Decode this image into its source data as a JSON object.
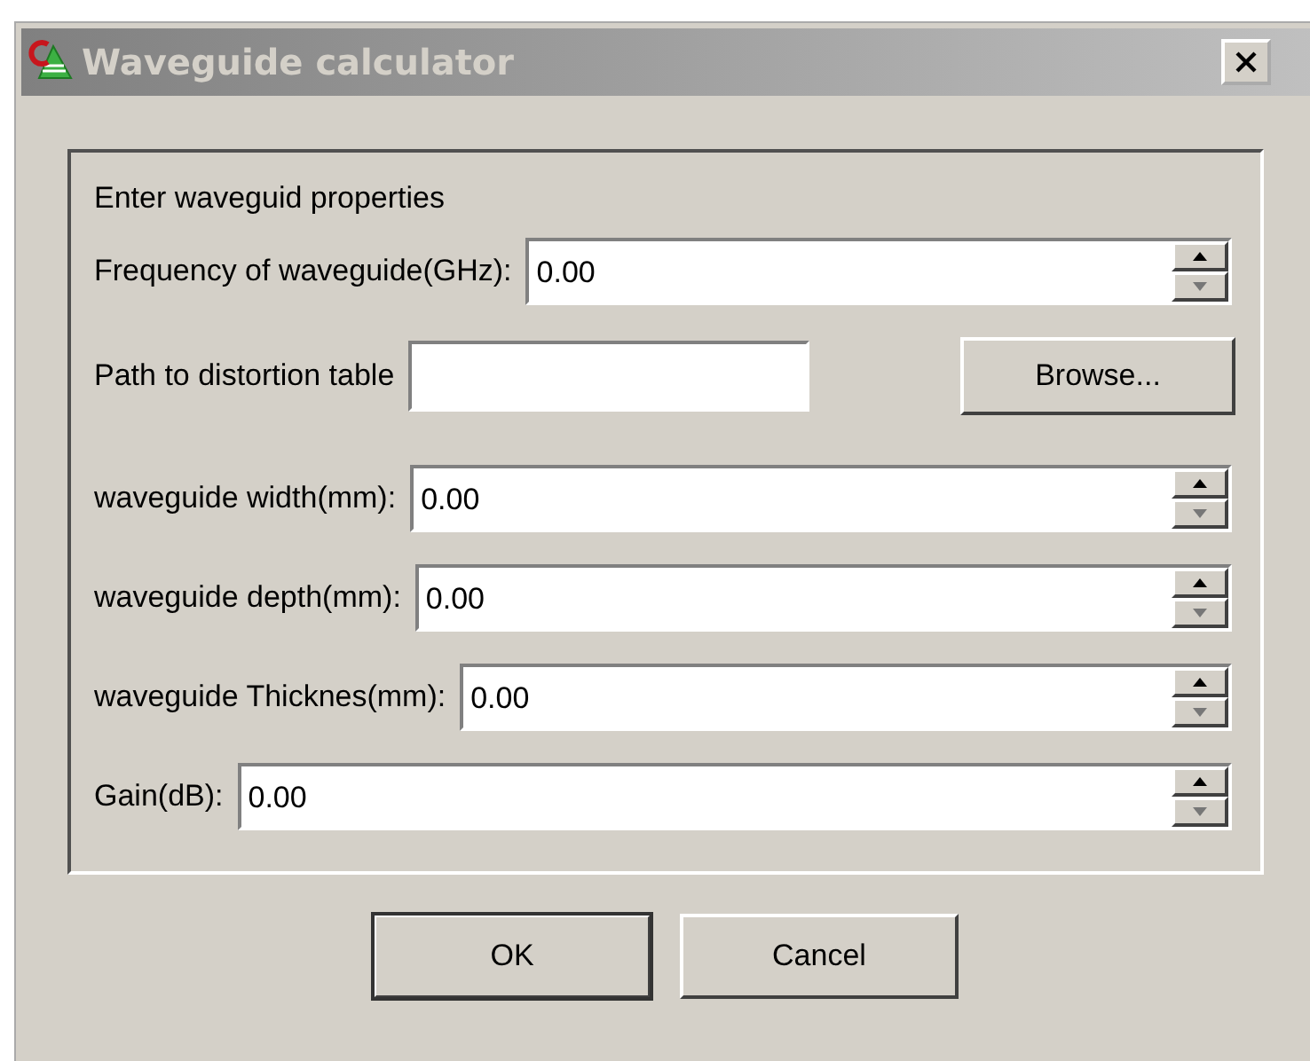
{
  "window": {
    "title": "Waveguide calculator"
  },
  "group": {
    "heading": "Enter waveguid properties",
    "rows": [
      {
        "kind": "spin",
        "label": "Frequency of waveguide(GHz):",
        "value": "0.00"
      },
      {
        "kind": "file",
        "label": "Path to distortion table",
        "value": "",
        "button": "Browse..."
      },
      {
        "kind": "spin",
        "label": "waveguide width(mm):",
        "value": "0.00"
      },
      {
        "kind": "spin",
        "label": "waveguide depth(mm):",
        "value": "0.00"
      },
      {
        "kind": "spin",
        "label": "waveguide Thicknes(mm):",
        "value": "0.00"
      },
      {
        "kind": "spin",
        "label": "Gain(dB):",
        "value": "0.00"
      }
    ]
  },
  "buttons": [
    {
      "label": "OK",
      "default": true
    },
    {
      "label": "Cancel",
      "default": false
    }
  ]
}
